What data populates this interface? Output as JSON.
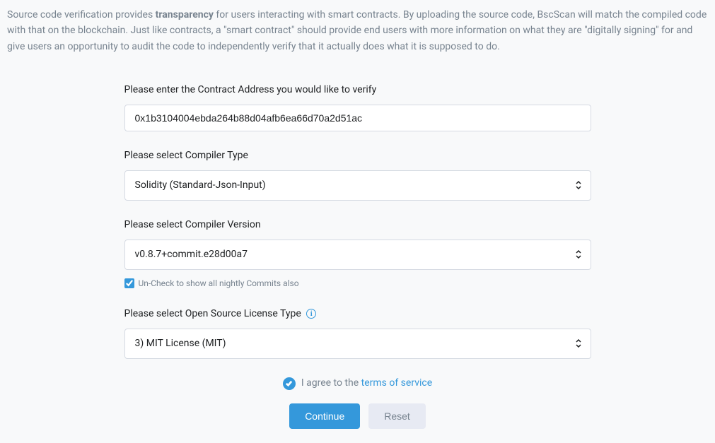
{
  "intro": {
    "prefix": "Source code verification provides ",
    "bold": "transparency",
    "suffix": " for users interacting with smart contracts. By uploading the source code, BscScan will match the compiled code with that on the blockchain. Just like contracts, a \"smart contract\" should provide end users with more information on what they are \"digitally signing\" for and give users an opportunity to audit the code to independently verify that it actually does what it is supposed to do."
  },
  "form": {
    "address": {
      "label": "Please enter the Contract Address you would like to verify",
      "value": "0x1b3104004ebda264b88d04afb6ea66d70a2d51ac"
    },
    "compilerType": {
      "label": "Please select Compiler Type",
      "value": "Solidity (Standard-Json-Input)"
    },
    "compilerVersion": {
      "label": "Please select Compiler Version",
      "value": "v0.8.7+commit.e28d00a7",
      "nightlyCheckbox": "Un-Check to show all nightly Commits also"
    },
    "license": {
      "label": "Please select Open Source License Type",
      "value": "3) MIT License (MIT)"
    },
    "terms": {
      "prefix": "I agree to the ",
      "link": "terms of service"
    },
    "buttons": {
      "continue": "Continue",
      "reset": "Reset"
    }
  }
}
